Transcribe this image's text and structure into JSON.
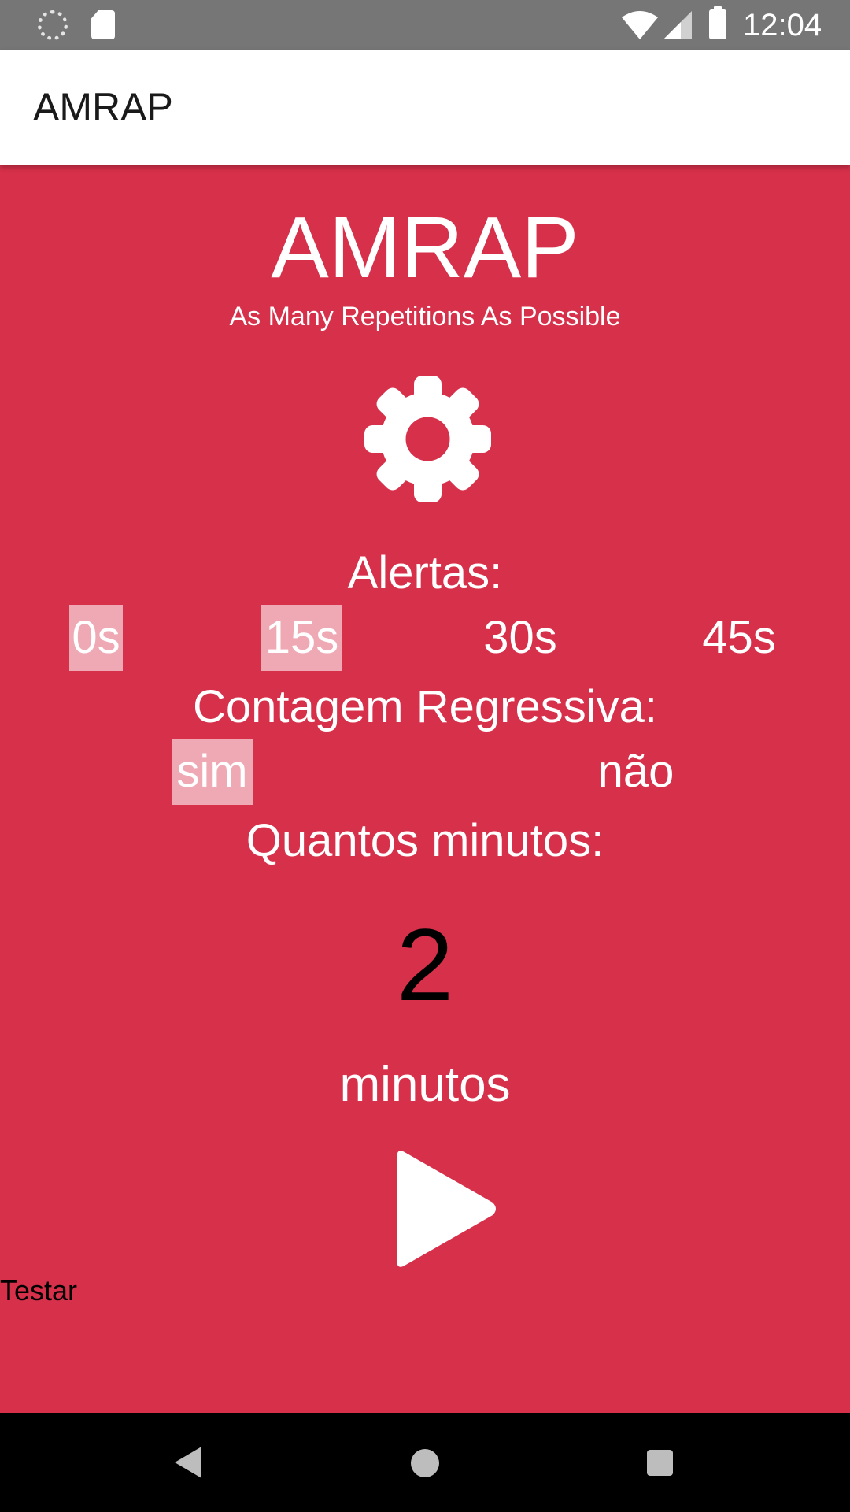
{
  "status_bar": {
    "time": "12:04",
    "icons": [
      "loading-icon",
      "sd-card-icon",
      "wifi-icon",
      "cell-signal-icon",
      "battery-icon"
    ]
  },
  "app_bar": {
    "title": "AMRAP"
  },
  "hero": {
    "title": "AMRAP",
    "subtitle": "As Many Repetitions As Possible"
  },
  "settings_icon": "gear-icon",
  "alerts": {
    "label": "Alertas:",
    "options": [
      "0s",
      "15s",
      "30s",
      "45s"
    ],
    "selected": [
      "0s",
      "15s"
    ]
  },
  "countdown": {
    "label": "Contagem Regressiva:",
    "options": [
      "sim",
      "não"
    ],
    "selected": "sim"
  },
  "minutes": {
    "label": "Quantos minutos:",
    "value": "2",
    "unit": "minutos"
  },
  "play_icon": "play-icon",
  "test_label": "Testar",
  "nav_bar": {
    "icons": [
      "back-icon",
      "home-icon",
      "recent-apps-icon"
    ]
  },
  "colors": {
    "background": "#d7304a",
    "selected_option": "#efa9b4",
    "status_bar": "#767676",
    "app_bar": "#ffffff",
    "nav_bar": "#000000"
  }
}
